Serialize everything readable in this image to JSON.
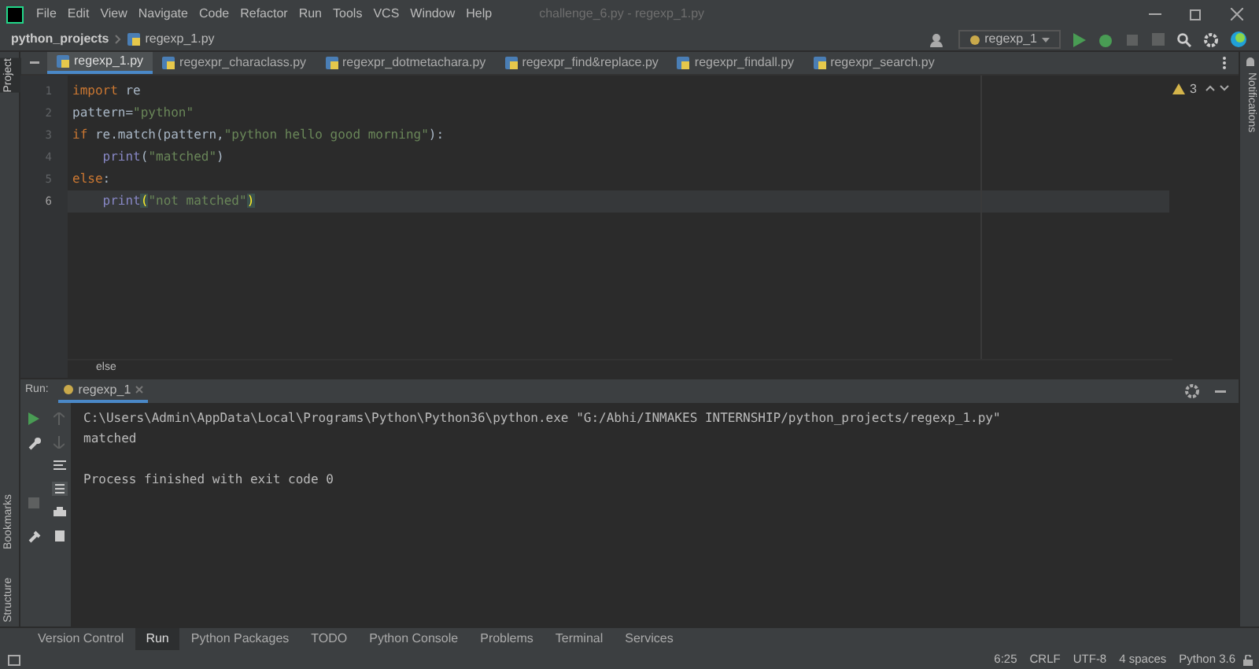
{
  "window": {
    "title": "challenge_6.py - regexp_1.py"
  },
  "menu": [
    "File",
    "Edit",
    "View",
    "Navigate",
    "Code",
    "Refactor",
    "Run",
    "Tools",
    "VCS",
    "Window",
    "Help"
  ],
  "breadcrumb": [
    "python_projects",
    "regexp_1.py"
  ],
  "run_config": {
    "label": "regexp_1",
    "stop_disabled": true
  },
  "left_stripe": [
    "Project",
    "Bookmarks",
    "Structure"
  ],
  "right_stripe": [
    "Notifications"
  ],
  "editor_tabs": [
    {
      "label": "regexp_1.py",
      "selected": true
    },
    {
      "label": "regexpr_characlass.py",
      "selected": false
    },
    {
      "label": "regexpr_dotmetachara.py",
      "selected": false
    },
    {
      "label": "regexpr_find&replace.py",
      "selected": false
    },
    {
      "label": "regexpr_findall.py",
      "selected": false
    },
    {
      "label": "regexpr_search.py",
      "selected": false
    }
  ],
  "inspections": {
    "warnings": "3"
  },
  "code": {
    "lines": [
      {
        "number": "1",
        "current": false,
        "tokens": [
          {
            "text": "import",
            "kind": "keyword"
          },
          {
            "text": " re",
            "kind": "plain"
          }
        ]
      },
      {
        "number": "2",
        "current": false,
        "tokens": [
          {
            "text": "pattern=",
            "kind": "plain"
          },
          {
            "text": "\"python\"",
            "kind": "string"
          }
        ]
      },
      {
        "number": "3",
        "current": false,
        "tokens": [
          {
            "text": "if",
            "kind": "keyword"
          },
          {
            "text": " re.match(pattern,",
            "kind": "plain"
          },
          {
            "text": "\"python hello good morning\"",
            "kind": "string"
          },
          {
            "text": "):",
            "kind": "plain"
          }
        ]
      },
      {
        "number": "4",
        "current": false,
        "tokens": [
          {
            "text": "    print",
            "kind": "builtin"
          },
          {
            "text": "(",
            "kind": "plain"
          },
          {
            "text": "\"matched\"",
            "kind": "string"
          },
          {
            "text": ")",
            "kind": "plain"
          }
        ]
      },
      {
        "number": "5",
        "current": false,
        "tokens": [
          {
            "text": "else",
            "kind": "keyword"
          },
          {
            "text": ":",
            "kind": "plain"
          }
        ]
      },
      {
        "number": "6",
        "current": true,
        "tokens": [
          {
            "text": "    print",
            "kind": "builtin"
          },
          {
            "text": "(",
            "kind": "brace"
          },
          {
            "text": "\"not matched\"",
            "kind": "string"
          },
          {
            "text": ")",
            "kind": "brace"
          }
        ]
      }
    ],
    "breadcrumb": "else"
  },
  "run_panel": {
    "label": "Run:",
    "tab": "regexp_1",
    "output": [
      {
        "kind": "command",
        "text": "C:\\Users\\Admin\\AppData\\Local\\Programs\\Python\\Python36\\python.exe \"G:/Abhi/INMAKES INTERNSHIP/python_projects/regexp_1.py\""
      },
      {
        "kind": "stdout",
        "text": "matched"
      },
      {
        "kind": "exit",
        "text": "Process finished with exit code 0"
      }
    ]
  },
  "tool_windows": [
    {
      "label": "Version Control",
      "selected": false
    },
    {
      "label": "Run",
      "selected": true
    },
    {
      "label": "Python Packages",
      "selected": false
    },
    {
      "label": "TODO",
      "selected": false
    },
    {
      "label": "Python Console",
      "selected": false
    },
    {
      "label": "Problems",
      "selected": false
    },
    {
      "label": "Terminal",
      "selected": false
    },
    {
      "label": "Services",
      "selected": false
    }
  ],
  "status_bar": [
    "6:25",
    "CRLF",
    "UTF-8",
    "4 spaces",
    "Python 3.6"
  ]
}
